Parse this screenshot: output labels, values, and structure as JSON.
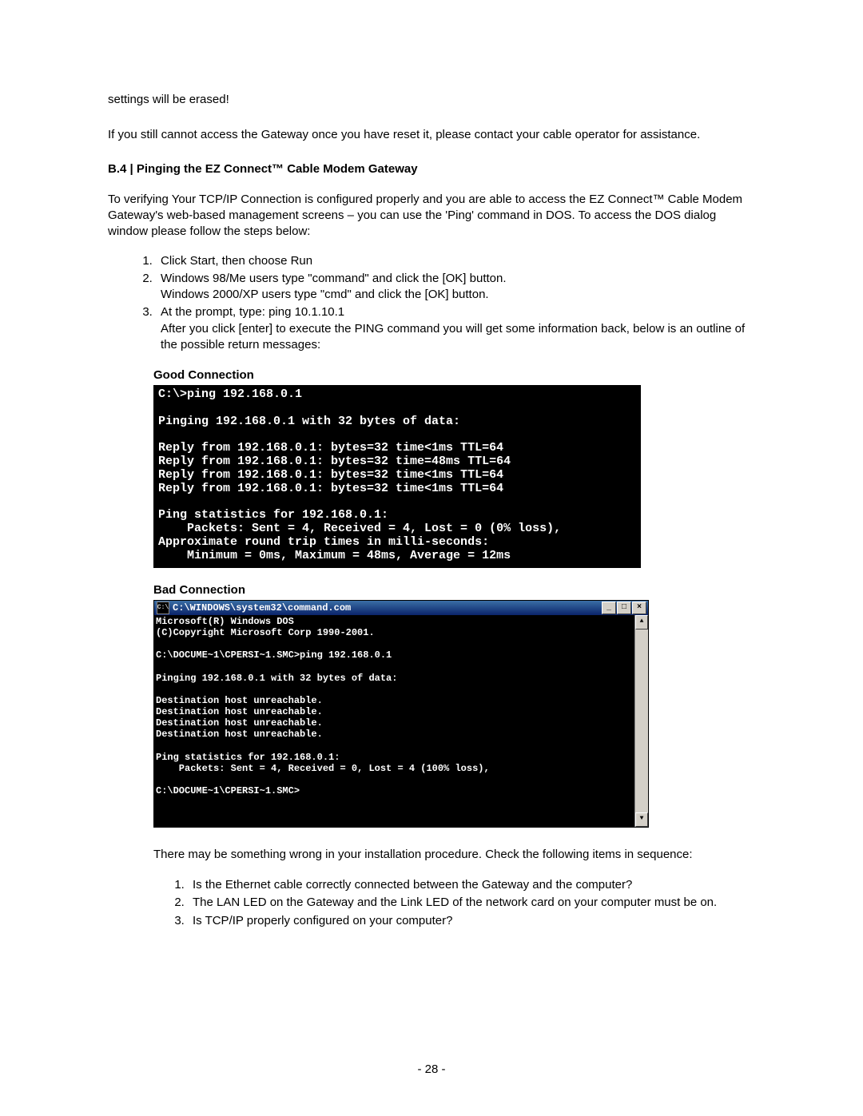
{
  "intro": {
    "p1": "settings will be erased!",
    "p2": "If you still cannot access the Gateway once you have reset it, please contact your cable operator for assistance."
  },
  "section_heading": "B.4 | Pinging the EZ Connect™ Cable Modem Gateway",
  "lead": "To verifying Your TCP/IP Connection is configured properly and you are able to access the EZ Connect™ Cable Modem Gateway's web-based management screens – you can use the 'Ping' command in DOS.  To access the DOS dialog window please follow the steps below:",
  "steps": {
    "s1": "Click Start, then choose Run",
    "s2a": "Windows 98/Me users type \"command\" and click the [OK] button.",
    "s2b": "Windows 2000/XP users type \"cmd\" and click the [OK] button.",
    "s3a": "At the prompt, type:  ping 10.1.10.1",
    "s3b": "After you click [enter] to execute the PING command you will get some information back, below is an outline of the possible return messages:"
  },
  "good": {
    "heading": "Good Connection",
    "lines": "C:\\>ping 192.168.0.1\n\nPinging 192.168.0.1 with 32 bytes of data:\n\nReply from 192.168.0.1: bytes=32 time<1ms TTL=64\nReply from 192.168.0.1: bytes=32 time=48ms TTL=64\nReply from 192.168.0.1: bytes=32 time<1ms TTL=64\nReply from 192.168.0.1: bytes=32 time<1ms TTL=64\n\nPing statistics for 192.168.0.1:\n    Packets: Sent = 4, Received = 4, Lost = 0 (0% loss),\nApproximate round trip times in milli-seconds:\n    Minimum = 0ms, Maximum = 48ms, Average = 12ms"
  },
  "bad": {
    "heading": "Bad Connection",
    "title_icon_text": "C:\\",
    "title": "C:\\WINDOWS\\system32\\command.com",
    "btn_min": "_",
    "btn_max": "□",
    "btn_close": "×",
    "lines": "Microsoft(R) Windows DOS\n(C)Copyright Microsoft Corp 1990-2001.\n\nC:\\DOCUME~1\\CPERSI~1.SMC>ping 192.168.0.1\n\nPinging 192.168.0.1 with 32 bytes of data:\n\nDestination host unreachable.\nDestination host unreachable.\nDestination host unreachable.\nDestination host unreachable.\n\nPing statistics for 192.168.0.1:\n    Packets: Sent = 4, Received = 0, Lost = 4 (100% loss),\n\nC:\\DOCUME~1\\CPERSI~1.SMC>",
    "scroll_up": "▲",
    "scroll_down": "▼"
  },
  "after": "There may be something wrong in your installation procedure. Check the following items in sequence:",
  "checks": {
    "c1": "Is the Ethernet cable correctly connected between the Gateway and the computer?",
    "c2": "The LAN LED on the Gateway and the Link LED of the network card on your computer must be on.",
    "c3": "Is TCP/IP properly configured on your computer?"
  },
  "page_number": "- 28 -"
}
